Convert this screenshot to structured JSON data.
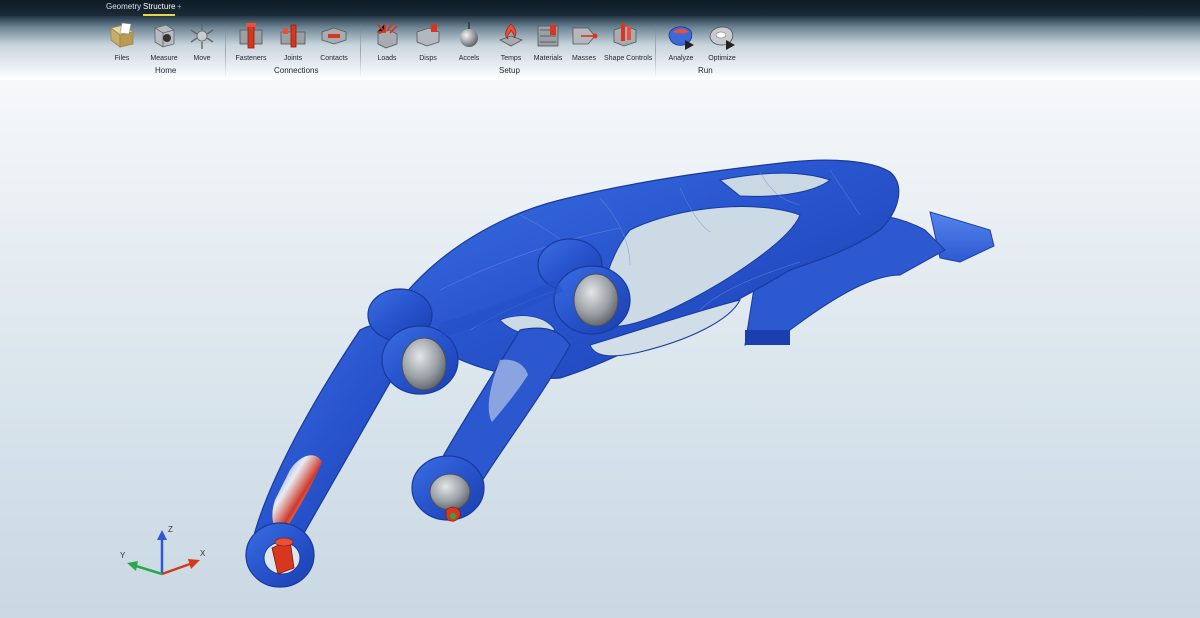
{
  "tabs": [
    {
      "label": "Geometry",
      "active": false
    },
    {
      "label": "Structure",
      "active": true
    }
  ],
  "add_tab_glyph": "+",
  "ribbon": {
    "groups": [
      {
        "label": "Home",
        "tools": [
          {
            "label": "Files",
            "icon": "files-icon"
          },
          {
            "label": "Measure",
            "icon": "measure-icon"
          },
          {
            "label": "Move",
            "icon": "move-icon"
          }
        ]
      },
      {
        "label": "Connections",
        "tools": [
          {
            "label": "Fasteners",
            "icon": "fasteners-icon"
          },
          {
            "label": "Joints",
            "icon": "joints-icon"
          },
          {
            "label": "Contacts",
            "icon": "contacts-icon"
          }
        ]
      },
      {
        "label": "Setup",
        "tools": [
          {
            "label": "Loads",
            "icon": "loads-icon"
          },
          {
            "label": "Disps",
            "icon": "disps-icon"
          },
          {
            "label": "Accels",
            "icon": "accels-icon"
          },
          {
            "label": "Temps",
            "icon": "temps-icon"
          },
          {
            "label": "Materials",
            "icon": "materials-icon"
          },
          {
            "label": "Masses",
            "icon": "masses-icon"
          },
          {
            "label": "Shape Controls",
            "icon": "shape-controls-icon"
          }
        ]
      },
      {
        "label": "Run",
        "tools": [
          {
            "label": "Analyze",
            "icon": "analyze-icon"
          },
          {
            "label": "Optimize",
            "icon": "optimize-icon"
          }
        ]
      }
    ]
  },
  "axis_triad": {
    "x": "X",
    "y": "Y",
    "z": "Z"
  },
  "colors": {
    "part_blue": "#2f5fd6",
    "stress_red": "#d8361e",
    "pin_gray": "#9aa0a6",
    "axis_x": "#d23a1f",
    "axis_y": "#2aa84a",
    "axis_z": "#2a5ad6"
  }
}
